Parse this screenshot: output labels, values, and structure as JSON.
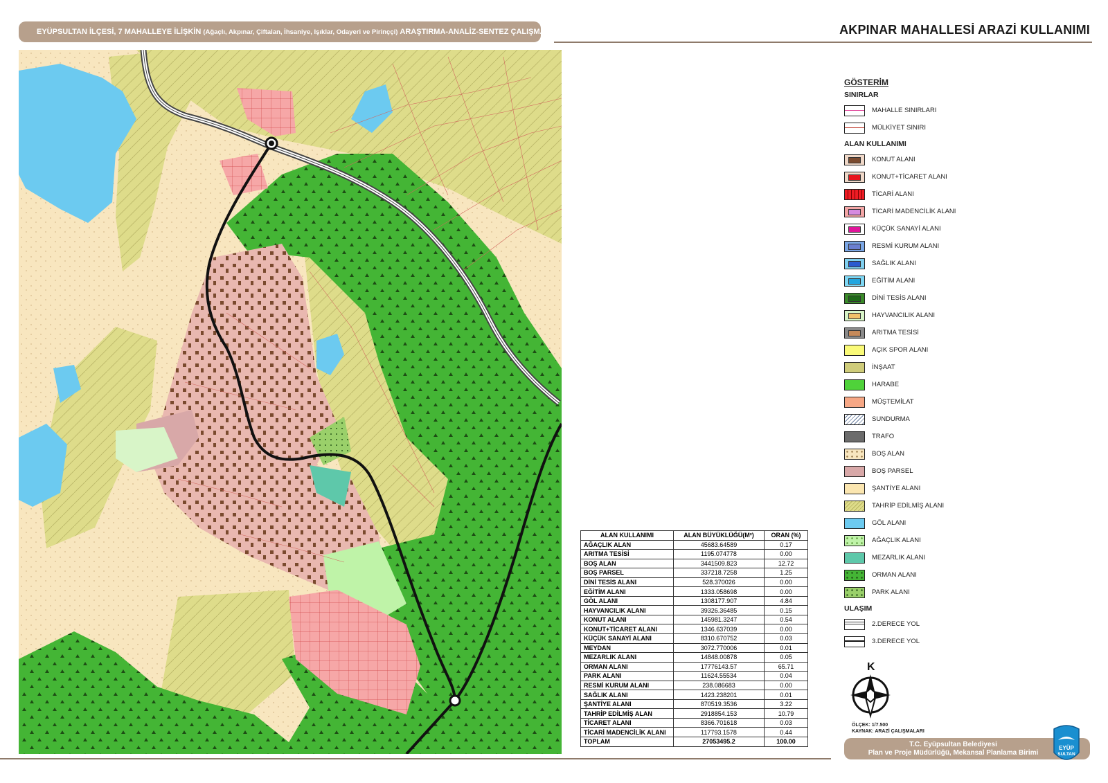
{
  "header": {
    "part1": "EYÜPSULTAN İLÇESİ, 7 MAHALLEYE İLİŞKİN",
    "part2": "(Ağaçlı, Akpınar, Çiftalan, İhsaniye, Işıklar, Odayeri ve Pirinççi)",
    "part3": "ARAŞTIRMA-ANALİZ-SENTEZ ÇALIŞMALARI"
  },
  "sheet_title": "AKPINAR MAHALLESİ ARAZİ KULLANIMI",
  "legend": {
    "title": "GÖSTERİM",
    "sections": [
      {
        "title": "SINIRLAR",
        "items": [
          {
            "label": "MAHALLE SINIRLARI",
            "type": "line",
            "color": "#e0449a"
          },
          {
            "label": "MÜLKİYET SINIRI",
            "type": "line",
            "color": "#c0392b"
          }
        ]
      },
      {
        "title": "ALAN KULLANIMI",
        "items": [
          {
            "label": "KONUT ALANI",
            "type": "inner",
            "bg": "#f0d8c8",
            "color": "#7a4a2e"
          },
          {
            "label": "KONUT+TİCARET ALANI",
            "type": "inner",
            "bg": "#f0d8c8",
            "color": "#e8141c"
          },
          {
            "label": "TİCARİ ALANI",
            "type": "hatch",
            "bg": "#ef1c24",
            "color": "#7a0000"
          },
          {
            "label": "TİCARİ MADENCİLİK ALANI",
            "type": "inner",
            "bg": "#f4a6a6",
            "color": "#d68ae0"
          },
          {
            "label": "KÜÇÜK SANAYİ ALANI",
            "type": "inner",
            "bg": "#ffffff",
            "color": "#e0149a"
          },
          {
            "label": "RESMİ KURUM ALANI",
            "type": "inner",
            "bg": "#7ba7e6",
            "color": "#6a7fd0"
          },
          {
            "label": "SAĞLIK ALANI",
            "type": "inner",
            "bg": "#80d0f0",
            "color": "#2a5ad0"
          },
          {
            "label": "EĞİTİM ALANI",
            "type": "inner",
            "bg": "#7fd8f5",
            "color": "#22a6e0"
          },
          {
            "label": "DİNİ TESİS ALANI",
            "type": "inner",
            "bg": "#3a8a2a",
            "color": "#1f6a18"
          },
          {
            "label": "HAYVANCILIK ALANI",
            "type": "inner",
            "bg": "#d8f5c8",
            "color": "#f2c06a"
          },
          {
            "label": "ARITMA TESİSİ",
            "type": "inner",
            "bg": "#8a8a8a",
            "color": "#c68a5a"
          },
          {
            "label": "AÇIK SPOR ALANI",
            "type": "fill",
            "bg": "#fafa78"
          },
          {
            "label": "İNŞAAT",
            "type": "fill",
            "bg": "#cfcc7a"
          },
          {
            "label": "HARABE",
            "type": "fill",
            "bg": "#4fd23a"
          },
          {
            "label": "MÜŞTEMİLAT",
            "type": "fill",
            "bg": "#f6a785"
          },
          {
            "label": "SUNDURMA",
            "type": "diag",
            "bg": "#ffffff",
            "color": "#6a7fa0"
          },
          {
            "label": "TRAFO",
            "type": "fill",
            "bg": "#6b6b6b"
          },
          {
            "label": "BOŞ ALAN",
            "type": "dots",
            "bg": "#f8e6bf",
            "color": "#9a7a4a"
          },
          {
            "label": "BOŞ PARSEL",
            "type": "fill",
            "bg": "#d8a8a8"
          },
          {
            "label": "ŞANTİYE ALANI",
            "type": "fill",
            "bg": "#fbe6b0"
          },
          {
            "label": "TAHRİP EDİLMİŞ ALANI",
            "type": "diag",
            "bg": "#dedc8a",
            "color": "#b8b460"
          },
          {
            "label": "GÖL ALANI",
            "type": "fill",
            "bg": "#6ccaf0"
          },
          {
            "label": "AĞAÇLIK ALANI",
            "type": "dots",
            "bg": "#bff3a8",
            "color": "#5a9a3a"
          },
          {
            "label": "MEZARLIK ALANI",
            "type": "fill",
            "bg": "#5ec8aa"
          },
          {
            "label": "ORMAN ALANI",
            "type": "dots",
            "bg": "#44b535",
            "color": "#1d4d14"
          },
          {
            "label": "PARK ALANI",
            "type": "dots",
            "bg": "#9ad06a",
            "color": "#2a5a1a"
          }
        ]
      },
      {
        "title": "ULAŞIM",
        "items": [
          {
            "label": "2.DERECE YOL",
            "type": "road2"
          },
          {
            "label": "3.DERECE YOL",
            "type": "road3"
          }
        ]
      }
    ]
  },
  "table": {
    "headers": [
      "ALAN KULLANIMI",
      "ALAN BÜYÜKLÜĞÜ(M²)",
      "ORAN (%)"
    ],
    "rows": [
      [
        "AĞAÇLIK ALAN",
        "45683.64589",
        "0.17"
      ],
      [
        "ARITMA TESİSİ",
        "1195.074778",
        "0.00"
      ],
      [
        "BOŞ ALAN",
        "3441509.823",
        "12.72"
      ],
      [
        "BOŞ PARSEL",
        "337218.7258",
        "1.25"
      ],
      [
        "DİNİ TESİS ALANI",
        "528.370026",
        "0.00"
      ],
      [
        "EĞİTİM ALANI",
        "1333.058698",
        "0.00"
      ],
      [
        "GÖL ALANI",
        "1308177.907",
        "4.84"
      ],
      [
        "HAYVANCILIK ALANI",
        "39326.36485",
        "0.15"
      ],
      [
        "KONUT ALANI",
        "145981.3247",
        "0.54"
      ],
      [
        "KONUT+TİCARET ALANI",
        "1346.637039",
        "0.00"
      ],
      [
        "KÜÇÜK SANAYİ ALANI",
        "8310.670752",
        "0.03"
      ],
      [
        "MEYDAN",
        "3072.770006",
        "0.01"
      ],
      [
        "MEZARLIK ALANI",
        "14848.00878",
        "0.05"
      ],
      [
        "ORMAN ALANI",
        "17776143.57",
        "65.71"
      ],
      [
        "PARK ALANI",
        "11624.55534",
        "0.04"
      ],
      [
        "RESMİ KURUM ALANI",
        "238.086683",
        "0.00"
      ],
      [
        "SAĞLIK ALANI",
        "1423.238201",
        "0.01"
      ],
      [
        "ŞANTİYE ALANI",
        "870519.3536",
        "3.22"
      ],
      [
        "TAHRİP EDİLMİŞ ALAN",
        "2918854.153",
        "10.79"
      ],
      [
        "TİCARET ALANI",
        "8366.701618",
        "0.03"
      ],
      [
        "TİCARİ MADENCİLİK ALANI",
        "117793.1578",
        "0.44"
      ]
    ],
    "total": [
      "TOPLAM",
      "27053495.2",
      "100.00"
    ]
  },
  "north_label": "K",
  "scale": "ÖLÇEK: 1/7.500",
  "source": "KAYNAK: ARAZİ ÇALIŞMALARI",
  "footer": {
    "line1": "T.C. Eyüpsultan Belediyesi",
    "line2": "Plan ve Proje Müdürlüğü, Mekansal Planlama Birimi"
  },
  "logo": {
    "line1": "EYÜP",
    "line2": "SULTAN"
  }
}
